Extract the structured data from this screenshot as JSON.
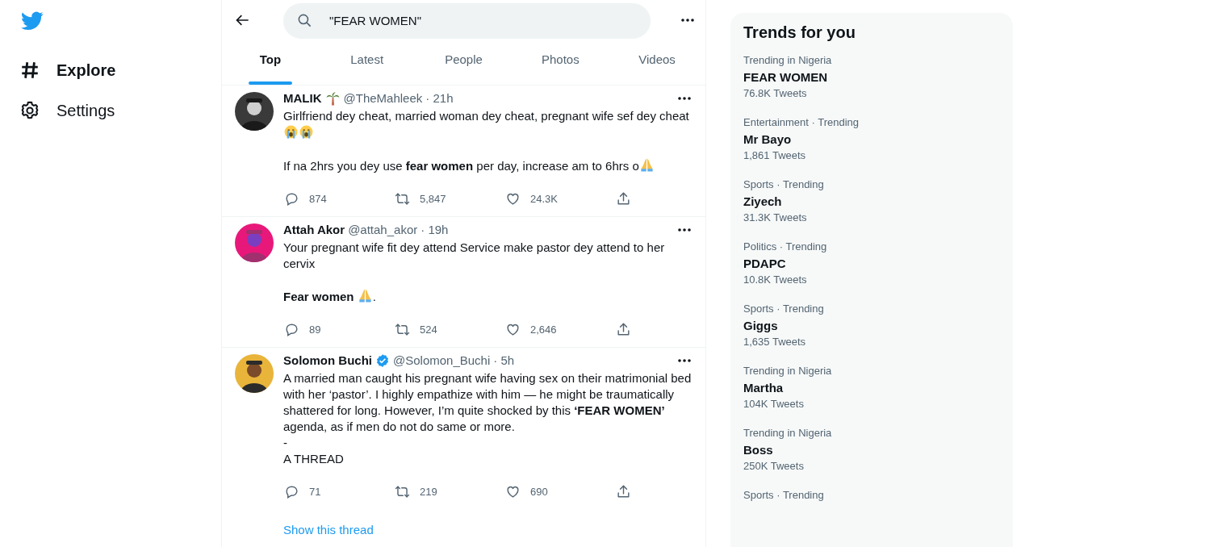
{
  "nav": {
    "items": [
      {
        "label": "Explore",
        "kind": "hash",
        "selected": true
      },
      {
        "label": "Settings",
        "kind": "gear",
        "selected": false
      }
    ]
  },
  "search": {
    "value": "\"FEAR WOMEN\""
  },
  "tabs": [
    {
      "label": "Top",
      "selected": true
    },
    {
      "label": "Latest",
      "selected": false
    },
    {
      "label": "People",
      "selected": false
    },
    {
      "label": "Photos",
      "selected": false
    },
    {
      "label": "Videos",
      "selected": false
    }
  ],
  "tweets": [
    {
      "name": "MALIK",
      "name_badges": [
        {
          "kind": "palm-tree"
        }
      ],
      "verified": false,
      "handle": "@TheMahleek",
      "time": "· 21h",
      "paragraphs": [
        [
          {
            "kind": "text",
            "text": "Girlfriend dey cheat, married woman dey cheat, pregnant wife sef dey cheat "
          },
          {
            "kind": "crying-face"
          },
          {
            "kind": "crying-face"
          }
        ],
        [
          {
            "kind": "text",
            "text": "If na 2hrs you dey use **fear women** per day, increase am to 6hrs o"
          },
          {
            "kind": "folded-hands"
          }
        ]
      ],
      "replies": "874",
      "retweets": "5,847",
      "likes": "24.3K"
    },
    {
      "name": "Attah Akor",
      "verified": false,
      "handle": "@attah_akor",
      "time": "· 19h",
      "paragraphs": [
        [
          {
            "kind": "text",
            "text": "Your pregnant wife fit dey attend  Service make pastor dey attend to her cervix"
          }
        ],
        [
          {
            "kind": "text",
            "text": "**Fear women** "
          },
          {
            "kind": "folded-hands"
          },
          {
            "kind": "text",
            "text": "."
          }
        ]
      ],
      "replies": "89",
      "retweets": "524",
      "likes": "2,646"
    },
    {
      "name": "Solomon Buchi",
      "verified": true,
      "handle": "@Solomon_Buchi",
      "time": "· 5h",
      "paragraphs": [
        [
          {
            "kind": "text",
            "text": "A married man caught his pregnant wife having sex on their matrimonial bed with her ‘pastor’. I highly empathize with him — he might be traumatically shattered for long. However, I’m quite shocked by this **‘FEAR WOMEN’** agenda, as if men do not do same or more."
          },
          {
            "kind": "break"
          },
          {
            "kind": "text",
            "text": "-"
          },
          {
            "kind": "break"
          },
          {
            "kind": "text",
            "text": "A THREAD"
          }
        ]
      ],
      "replies": "71",
      "retweets": "219",
      "likes": "690",
      "thread_link": "Show this thread"
    }
  ],
  "trends": {
    "title": "Trends for you",
    "items": [
      {
        "context": "Trending in Nigeria",
        "name": "FEAR WOMEN",
        "count": "76.8K Tweets"
      },
      {
        "context": "Entertainment · Trending",
        "name": "Mr Bayo",
        "count": "1,861 Tweets"
      },
      {
        "context": "Sports · Trending",
        "name": "Ziyech",
        "count": "31.3K Tweets"
      },
      {
        "context": "Politics · Trending",
        "name": "PDAPC",
        "count": "10.8K Tweets"
      },
      {
        "context": "Sports · Trending",
        "name": "Giggs",
        "count": "1,635 Tweets"
      },
      {
        "context": "Trending in Nigeria",
        "name": "Martha",
        "count": "104K Tweets"
      },
      {
        "context": "Trending in Nigeria",
        "name": "Boss",
        "count": "250K Tweets"
      },
      {
        "context": "Sports · Trending"
      }
    ]
  }
}
